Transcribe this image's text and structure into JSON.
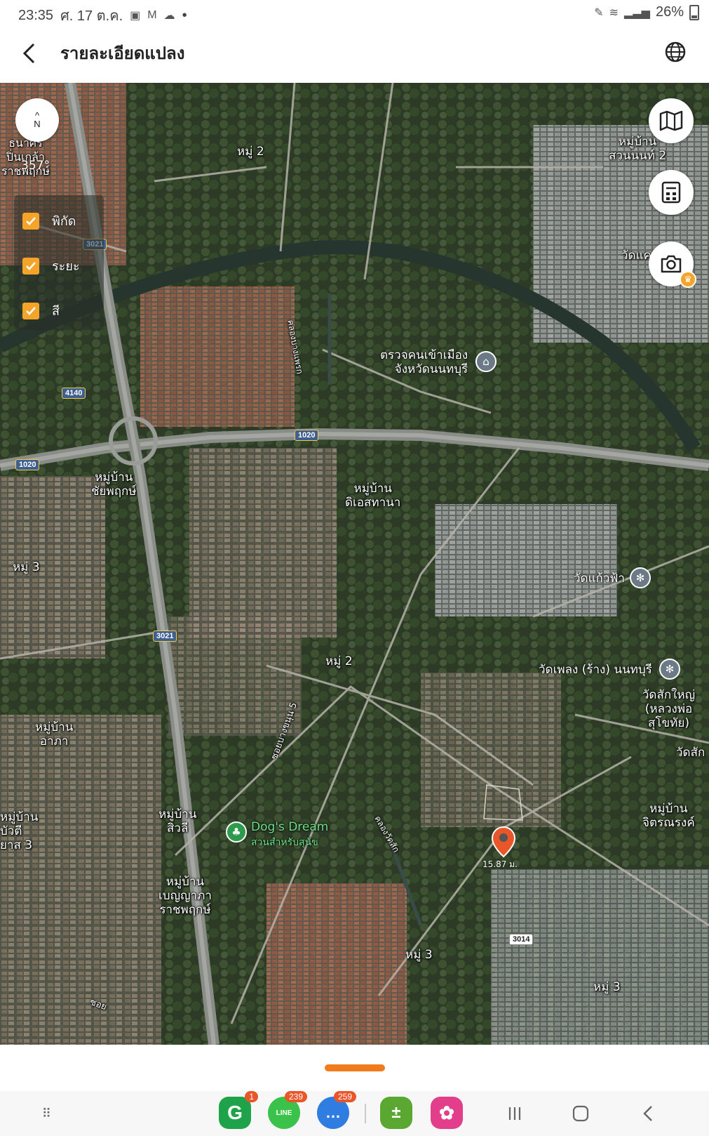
{
  "status_bar": {
    "time": "23:35",
    "date": "ศ. 17 ต.ค.",
    "dot": "•",
    "battery": "26%"
  },
  "app_bar": {
    "title": "รายละเอียดแปลง"
  },
  "map": {
    "compass_letter": "N",
    "compass_arrow": "^",
    "bearing": "357°",
    "layers": [
      {
        "label": "พิกัด",
        "checked": true
      },
      {
        "label": "ระยะ",
        "checked": true
      },
      {
        "label": "สี",
        "checked": true
      }
    ],
    "area_labels": [
      {
        "text": "ธนาศร\nปิ่นเกล้า\nราชพฤกษ์"
      },
      {
        "text": "หมู่ 2"
      },
      {
        "text": "หมู่บ้าน\nสวนนนท์ 2"
      },
      {
        "text": "วัดแค"
      },
      {
        "text": "หมู่บ้าน\nชัยพฤกษ์"
      },
      {
        "text": "หมู่บ้าน\nดิเอสทานา"
      },
      {
        "text": "หมู่ 3"
      },
      {
        "text": "หมู่ 2"
      },
      {
        "text": "หมู่บ้าน\nอาภา"
      },
      {
        "text": "หมู่บ้าน\nสิวลี"
      },
      {
        "text": "หมู่บ้าน\nเบญญาภา\nราชพฤกษ์"
      },
      {
        "text": "หมู่บ้าน\nบัวตี\nยาส 3"
      },
      {
        "text": "หมู่ 3"
      },
      {
        "text": "หมู่ 3"
      },
      {
        "text": "หมู่บ้าน\nจิตรณรงค์"
      },
      {
        "text": "วัดสัก"
      },
      {
        "text": "วัดสักใหญ่\n(หลวงพ่อสุโขทัย)"
      }
    ],
    "road_labels": [
      "คลองบางแพรก",
      "ซอยบางขนุน 5",
      "คลองวัดสัก",
      "ซอย"
    ],
    "route_shields": [
      "3021",
      "4140",
      "1020",
      "1020",
      "1020",
      "3021",
      "3014"
    ],
    "pois": [
      {
        "name": "ตรวจคนเข้าเมือง\nจังหวัดนนทบุรี",
        "icon": "government-icon"
      },
      {
        "name": "วัดแก้วฟ้า",
        "icon": "temple-icon"
      },
      {
        "name": "วัดเพลง (ร้าง) นนทบุรี",
        "icon": "temple-icon"
      },
      {
        "name": "Dog's Dream",
        "subname": "สวนสำหรับสุนัข",
        "icon": "park-icon"
      }
    ],
    "pin": {
      "area": "15.87 ม.",
      "color": "#e8562a"
    }
  },
  "nav_bar": {
    "apps": [
      {
        "name": "grab",
        "letter": "G",
        "badge": "1",
        "color": "#1fa34a"
      },
      {
        "name": "line",
        "letter": "LINE",
        "badge": "239",
        "color": "#3bc24a"
      },
      {
        "name": "messages",
        "letter": "…",
        "badge": "259",
        "color": "#2f7de1"
      },
      {
        "name": "calculator",
        "letter": "±",
        "badge": "",
        "color": "#5aa832"
      },
      {
        "name": "gallery",
        "letter": "✿",
        "badge": "",
        "color": "#e23e8c"
      }
    ]
  },
  "colors": {
    "accent": "#f5a42a",
    "pin": "#e8562a",
    "grabber": "#f07c1e"
  }
}
